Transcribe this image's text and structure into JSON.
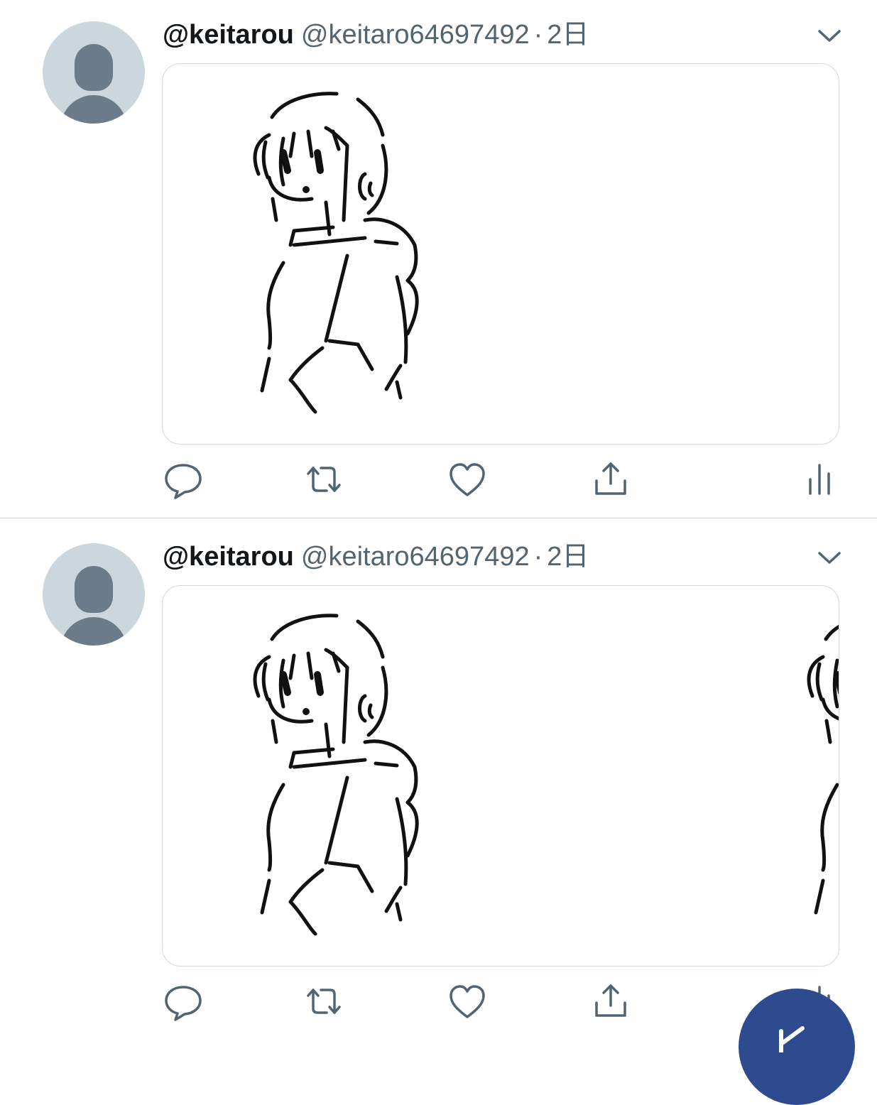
{
  "tweets": [
    {
      "display_name": "@keitarou",
      "handle": "@keitaro64697492",
      "separator": "·",
      "time": "2日",
      "media_icon": "line-drawing-girl-image",
      "actions": [
        "reply-icon",
        "retweet-icon",
        "like-icon",
        "share-icon",
        "analytics-icon"
      ]
    },
    {
      "display_name": "@keitarou",
      "handle": "@keitaro64697492",
      "separator": "·",
      "time": "2日",
      "media_icon": "line-drawing-girl-image",
      "actions": [
        "reply-icon",
        "retweet-icon",
        "like-icon",
        "share-icon",
        "analytics-icon"
      ]
    }
  ],
  "fab": {
    "icon": "compose-icon",
    "color": "#2f4b8f"
  },
  "colors": {
    "avatar_bg": "#ccd6dd",
    "avatar_fg": "#6b7b8a",
    "secondary_text": "#536471",
    "icon": "#536471"
  }
}
